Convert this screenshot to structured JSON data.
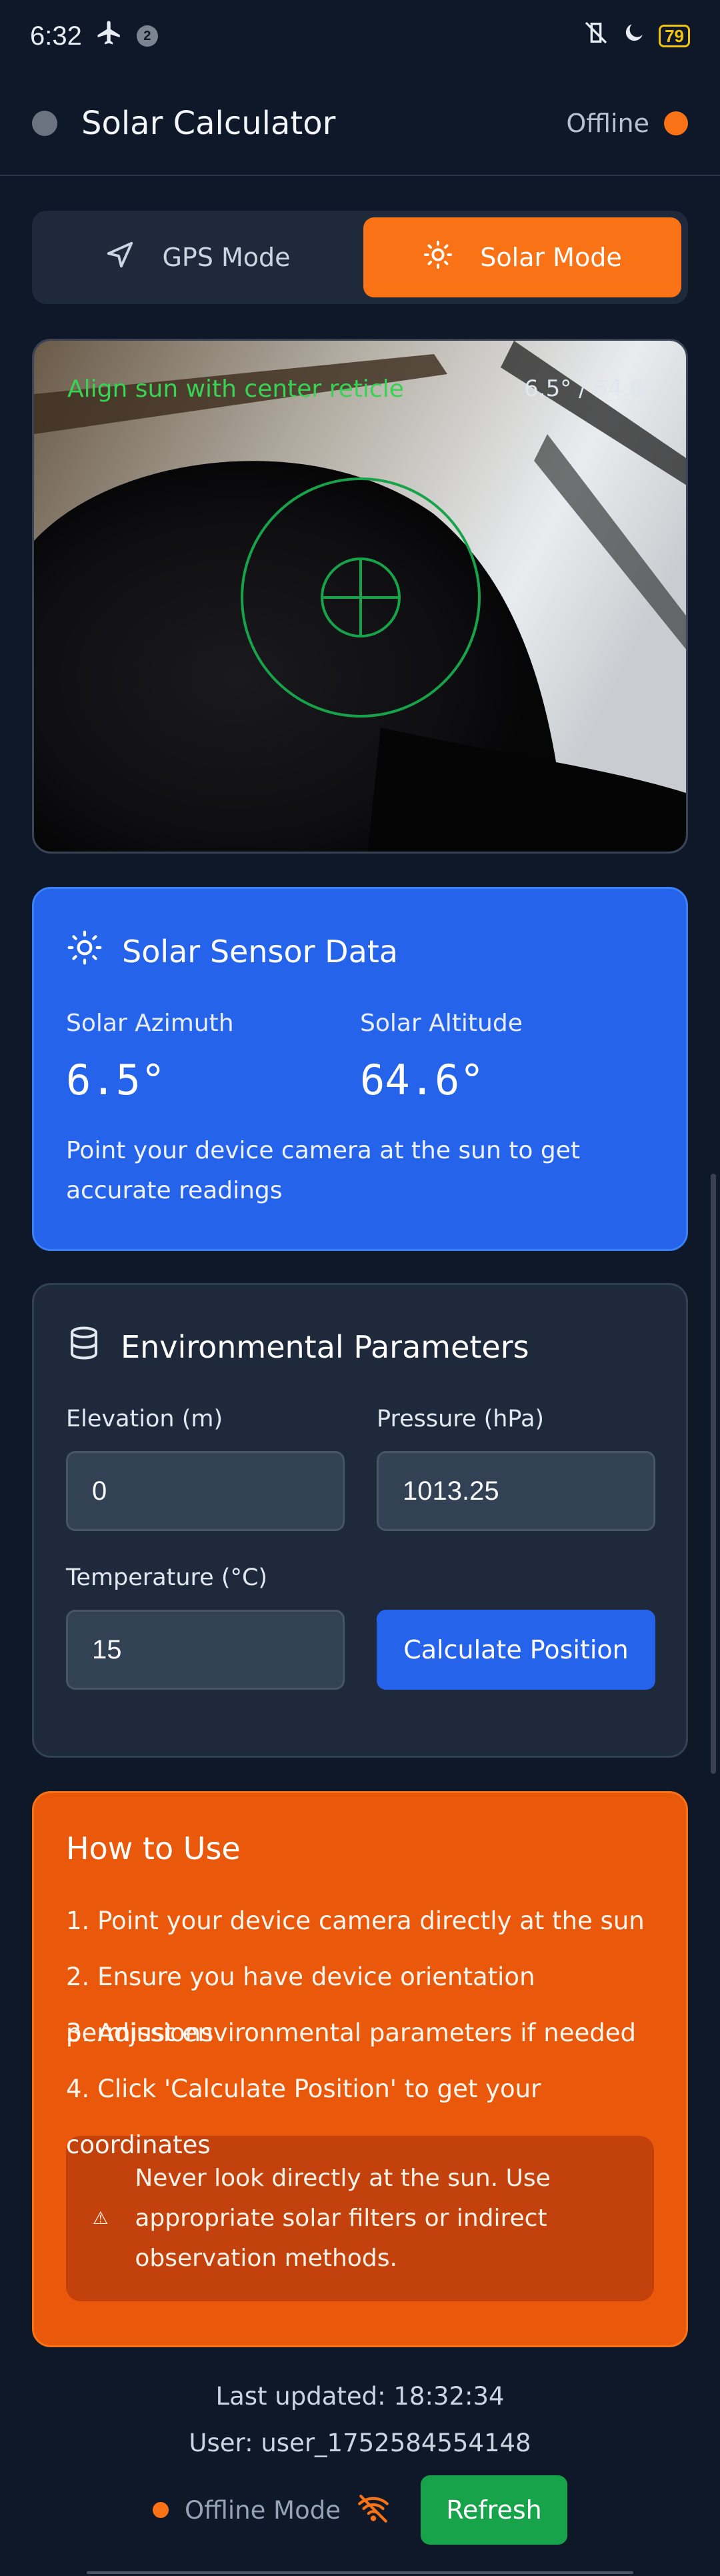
{
  "status_bar": {
    "time": "6:32",
    "notification_count": "2",
    "battery": "79"
  },
  "header": {
    "title": "Solar Calculator",
    "connection_status": "Offline"
  },
  "mode_toggle": {
    "gps_label": "GPS Mode",
    "solar_label": "Solar Mode",
    "active": "Solar Mode"
  },
  "camera": {
    "hint": "Align sun with center reticle",
    "readout": "6.5° / 64.6°"
  },
  "sensor": {
    "title": "Solar Sensor Data",
    "azimuth_label": "Solar Azimuth",
    "azimuth_value": "6.5°",
    "altitude_label": "Solar Altitude",
    "altitude_value": "64.6°",
    "note": "Point your device camera at the sun to get accurate readings"
  },
  "environment": {
    "title": "Environmental Parameters",
    "elevation_label": "Elevation (m)",
    "elevation_value": "0",
    "pressure_label": "Pressure (hPa)",
    "pressure_value": "1013.25",
    "temperature_label": "Temperature (°C)",
    "temperature_value": "15",
    "calculate_label": "Calculate Position"
  },
  "howto": {
    "title": "How to Use",
    "steps": [
      "1. Point your device camera directly at the sun",
      "2. Ensure you have device orientation permissions",
      "3. Adjust environmental parameters if needed",
      "4. Click 'Calculate Position' to get your coordinates"
    ],
    "warning_icon": "⚠",
    "warning": "Never look directly at the sun. Use appropriate solar filters or indirect observation methods."
  },
  "footer": {
    "last_updated": "Last updated: 18:32:34",
    "user": "User: user_1752584554148",
    "mode_label": "Offline Mode",
    "refresh_label": "Refresh"
  },
  "colors": {
    "background": "#0f1828",
    "accent": "#f97316",
    "primary": "#2563eb",
    "success": "#16a34a",
    "reticle": "#16a34a"
  }
}
